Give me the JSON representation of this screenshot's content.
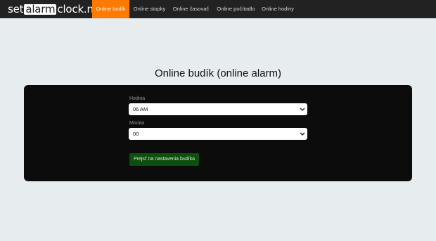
{
  "logo": {
    "part1": "set",
    "part2": "alarm",
    "part3": "clock.net"
  },
  "nav": [
    {
      "label": "Online budík",
      "active": true
    },
    {
      "label": "Online stopky",
      "active": false
    },
    {
      "label": "Online časovač",
      "active": false
    },
    {
      "label": "Online počítadlo",
      "active": false
    },
    {
      "label": "Online hodiny",
      "active": false
    }
  ],
  "colors": {
    "nav_bg": "#222222",
    "active": "#ff7a00",
    "panel": "#0c0c0c",
    "button": "#0d4f0d"
  },
  "title": "Online budík (online alarm)",
  "form": {
    "hour_label": "Hodina",
    "hour_value": "06 AM",
    "minute_label": "Minúta",
    "minute_value": "00",
    "submit_label": "Prejsť na nastavenia budíka"
  },
  "icons": {
    "select": "chevron-down-icon"
  }
}
